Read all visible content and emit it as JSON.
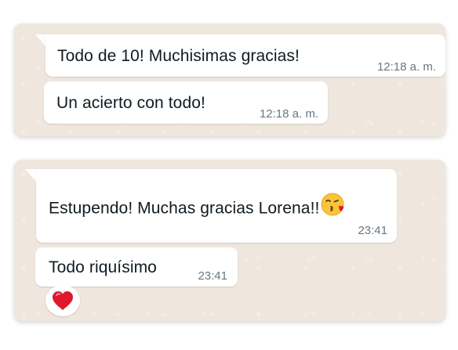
{
  "conversation_1": {
    "messages": [
      {
        "text": "Todo de 10! Muchisimas gracias!",
        "time": "12:18 a. m."
      },
      {
        "text": "Un acierto con todo!",
        "time": "12:18 a. m."
      }
    ]
  },
  "conversation_2": {
    "messages": [
      {
        "text": "Estupendo! Muchas gracias Lorena!!",
        "emoji": "kissing-face-heart-icon",
        "time": "23:41"
      },
      {
        "text": "Todo riquísimo",
        "time": "23:41",
        "reaction": "red-heart-icon"
      }
    ]
  },
  "colors": {
    "chat_background": "#efe7de",
    "bubble": "#ffffff",
    "text": "#111b21",
    "timestamp": "#667781",
    "reaction_heart": "#e0182d"
  }
}
